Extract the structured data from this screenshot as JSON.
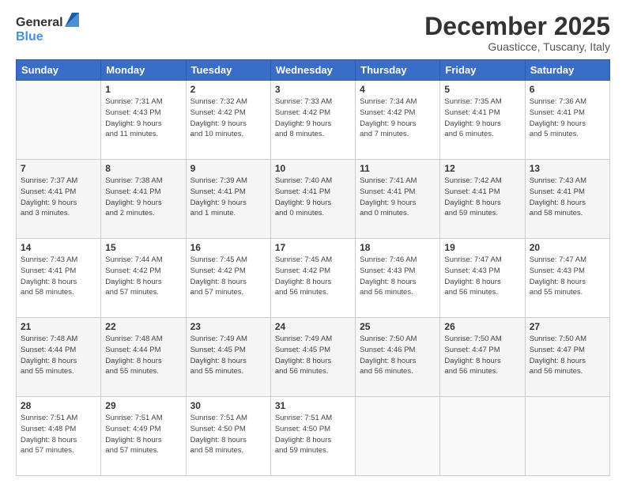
{
  "logo": {
    "general": "General",
    "blue": "Blue"
  },
  "header": {
    "month": "December 2025",
    "location": "Guasticce, Tuscany, Italy"
  },
  "weekdays": [
    "Sunday",
    "Monday",
    "Tuesday",
    "Wednesday",
    "Thursday",
    "Friday",
    "Saturday"
  ],
  "weeks": [
    [
      {
        "day": "",
        "info": ""
      },
      {
        "day": "1",
        "info": "Sunrise: 7:31 AM\nSunset: 4:43 PM\nDaylight: 9 hours\nand 11 minutes."
      },
      {
        "day": "2",
        "info": "Sunrise: 7:32 AM\nSunset: 4:42 PM\nDaylight: 9 hours\nand 10 minutes."
      },
      {
        "day": "3",
        "info": "Sunrise: 7:33 AM\nSunset: 4:42 PM\nDaylight: 9 hours\nand 8 minutes."
      },
      {
        "day": "4",
        "info": "Sunrise: 7:34 AM\nSunset: 4:42 PM\nDaylight: 9 hours\nand 7 minutes."
      },
      {
        "day": "5",
        "info": "Sunrise: 7:35 AM\nSunset: 4:41 PM\nDaylight: 9 hours\nand 6 minutes."
      },
      {
        "day": "6",
        "info": "Sunrise: 7:36 AM\nSunset: 4:41 PM\nDaylight: 9 hours\nand 5 minutes."
      }
    ],
    [
      {
        "day": "7",
        "info": "Sunrise: 7:37 AM\nSunset: 4:41 PM\nDaylight: 9 hours\nand 3 minutes."
      },
      {
        "day": "8",
        "info": "Sunrise: 7:38 AM\nSunset: 4:41 PM\nDaylight: 9 hours\nand 2 minutes."
      },
      {
        "day": "9",
        "info": "Sunrise: 7:39 AM\nSunset: 4:41 PM\nDaylight: 9 hours\nand 1 minute."
      },
      {
        "day": "10",
        "info": "Sunrise: 7:40 AM\nSunset: 4:41 PM\nDaylight: 9 hours\nand 0 minutes."
      },
      {
        "day": "11",
        "info": "Sunrise: 7:41 AM\nSunset: 4:41 PM\nDaylight: 9 hours\nand 0 minutes."
      },
      {
        "day": "12",
        "info": "Sunrise: 7:42 AM\nSunset: 4:41 PM\nDaylight: 8 hours\nand 59 minutes."
      },
      {
        "day": "13",
        "info": "Sunrise: 7:43 AM\nSunset: 4:41 PM\nDaylight: 8 hours\nand 58 minutes."
      }
    ],
    [
      {
        "day": "14",
        "info": "Sunrise: 7:43 AM\nSunset: 4:41 PM\nDaylight: 8 hours\nand 58 minutes."
      },
      {
        "day": "15",
        "info": "Sunrise: 7:44 AM\nSunset: 4:42 PM\nDaylight: 8 hours\nand 57 minutes."
      },
      {
        "day": "16",
        "info": "Sunrise: 7:45 AM\nSunset: 4:42 PM\nDaylight: 8 hours\nand 57 minutes."
      },
      {
        "day": "17",
        "info": "Sunrise: 7:45 AM\nSunset: 4:42 PM\nDaylight: 8 hours\nand 56 minutes."
      },
      {
        "day": "18",
        "info": "Sunrise: 7:46 AM\nSunset: 4:43 PM\nDaylight: 8 hours\nand 56 minutes."
      },
      {
        "day": "19",
        "info": "Sunrise: 7:47 AM\nSunset: 4:43 PM\nDaylight: 8 hours\nand 56 minutes."
      },
      {
        "day": "20",
        "info": "Sunrise: 7:47 AM\nSunset: 4:43 PM\nDaylight: 8 hours\nand 55 minutes."
      }
    ],
    [
      {
        "day": "21",
        "info": "Sunrise: 7:48 AM\nSunset: 4:44 PM\nDaylight: 8 hours\nand 55 minutes."
      },
      {
        "day": "22",
        "info": "Sunrise: 7:48 AM\nSunset: 4:44 PM\nDaylight: 8 hours\nand 55 minutes."
      },
      {
        "day": "23",
        "info": "Sunrise: 7:49 AM\nSunset: 4:45 PM\nDaylight: 8 hours\nand 55 minutes."
      },
      {
        "day": "24",
        "info": "Sunrise: 7:49 AM\nSunset: 4:45 PM\nDaylight: 8 hours\nand 56 minutes."
      },
      {
        "day": "25",
        "info": "Sunrise: 7:50 AM\nSunset: 4:46 PM\nDaylight: 8 hours\nand 56 minutes."
      },
      {
        "day": "26",
        "info": "Sunrise: 7:50 AM\nSunset: 4:47 PM\nDaylight: 8 hours\nand 56 minutes."
      },
      {
        "day": "27",
        "info": "Sunrise: 7:50 AM\nSunset: 4:47 PM\nDaylight: 8 hours\nand 56 minutes."
      }
    ],
    [
      {
        "day": "28",
        "info": "Sunrise: 7:51 AM\nSunset: 4:48 PM\nDaylight: 8 hours\nand 57 minutes."
      },
      {
        "day": "29",
        "info": "Sunrise: 7:51 AM\nSunset: 4:49 PM\nDaylight: 8 hours\nand 57 minutes."
      },
      {
        "day": "30",
        "info": "Sunrise: 7:51 AM\nSunset: 4:50 PM\nDaylight: 8 hours\nand 58 minutes."
      },
      {
        "day": "31",
        "info": "Sunrise: 7:51 AM\nSunset: 4:50 PM\nDaylight: 8 hours\nand 59 minutes."
      },
      {
        "day": "",
        "info": ""
      },
      {
        "day": "",
        "info": ""
      },
      {
        "day": "",
        "info": ""
      }
    ]
  ]
}
